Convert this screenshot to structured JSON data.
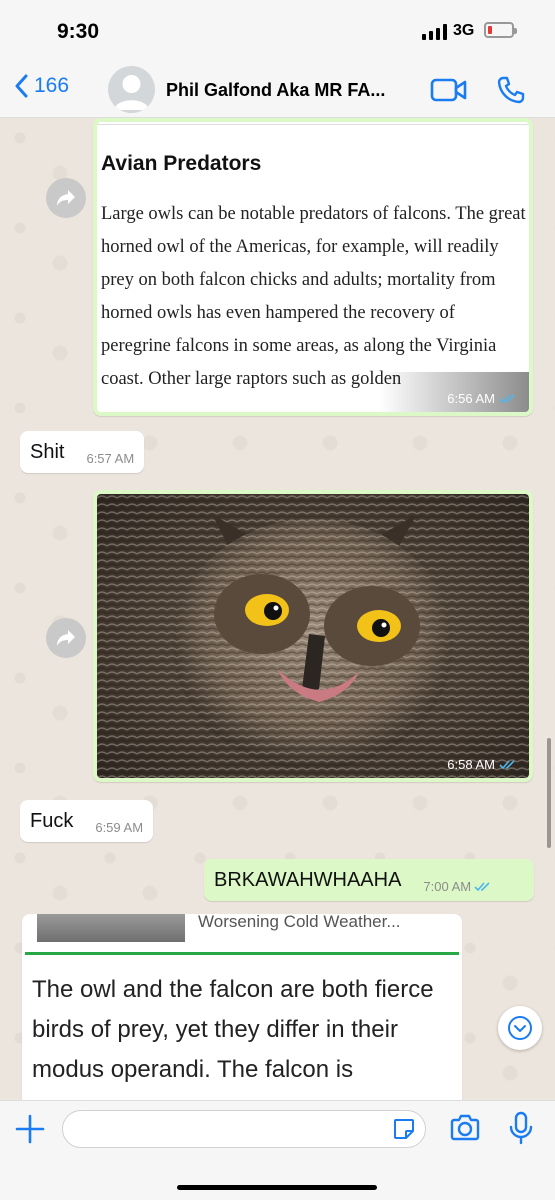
{
  "status": {
    "time": "9:30",
    "network": "3G"
  },
  "header": {
    "back_count": "166",
    "title": "Phil Galfond Aka MR FA..."
  },
  "messages": {
    "article": {
      "heading": "Avian Predators",
      "body": "Large owls can be notable predators of falcons. The great horned owl of the Americas, for example, will readily prey on both falcon chicks and adults; mortality from horned owls has even hampered the recovery of peregrine falcons in some areas, as along the Virginia coast. Other large raptors such as golden",
      "time": "6:56 AM"
    },
    "shit": {
      "text": "Shit",
      "time": "6:57 AM"
    },
    "owl_photo": {
      "time": "6:58 AM"
    },
    "fuck": {
      "text": "Fuck",
      "time": "6:59 AM"
    },
    "brkawah": {
      "text": "BRKAWAHWHAAHA",
      "time": "7:00 AM"
    },
    "preview": {
      "title": "Worsening Cold Weather...",
      "body": "The owl and the falcon are both fierce birds of prey, yet they differ in their modus operandi. The falcon is"
    }
  },
  "colors": {
    "accent": "#1a7cf0",
    "outgoing": "#dcf8c6",
    "incoming": "#ffffff",
    "read_ticks": "#4fb6ec"
  },
  "icons": [
    "chevron-left-icon",
    "video-call-icon",
    "phone-call-icon",
    "forward-icon",
    "double-check-icon",
    "chevron-down-icon",
    "plus-icon",
    "sticker-icon",
    "camera-icon",
    "microphone-icon"
  ]
}
